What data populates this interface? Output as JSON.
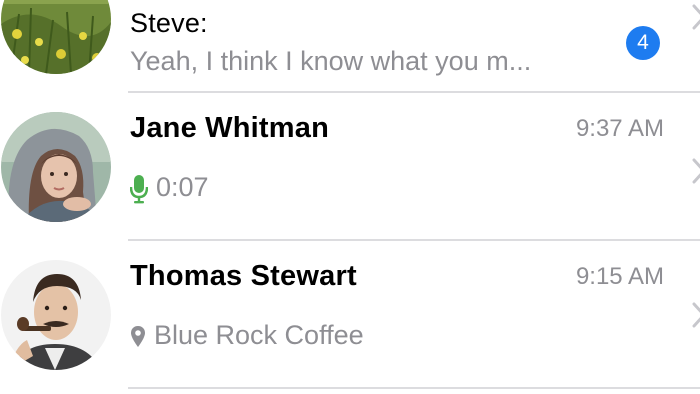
{
  "conversations": [
    {
      "name": "Steve:",
      "preview": "Yeah, I think I know what you m...",
      "unread_count": "4",
      "avatar_icon": "photo-flowers-avatar"
    },
    {
      "name": "Jane Whitman",
      "time": "9:37 AM",
      "preview": "0:07",
      "preview_icon": "microphone-icon",
      "preview_icon_color": "#4caf50",
      "avatar_icon": "photo-woman-hood-avatar"
    },
    {
      "name": "Thomas Stewart",
      "time": "9:15 AM",
      "preview": "Blue Rock Coffee",
      "preview_icon": "location-pin-icon",
      "avatar_icon": "photo-man-pipe-avatar"
    }
  ],
  "colors": {
    "badge": "#1e7cf0",
    "secondary_text": "#8e8e93",
    "divider": "#dcdcdf"
  }
}
